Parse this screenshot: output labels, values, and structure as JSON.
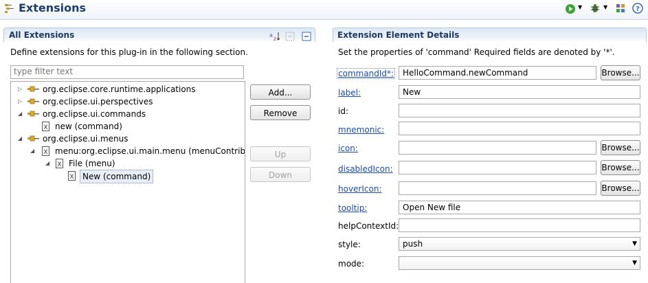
{
  "header": {
    "title": "Extensions"
  },
  "all_extensions": {
    "title": "All Extensions",
    "description": "Define extensions for this plug-in in the following section.",
    "filter_placeholder": "type filter text",
    "tree": [
      {
        "label": "org.eclipse.core.runtime.applications",
        "expanded": false
      },
      {
        "label": "org.eclipse.ui.perspectives",
        "expanded": false
      },
      {
        "label": "org.eclipse.ui.commands",
        "expanded": true
      },
      {
        "label": "new (command)"
      },
      {
        "label": "org.eclipse.ui.menus",
        "expanded": true
      },
      {
        "label": "menu:org.eclipse.ui.main.menu (menuContribution"
      },
      {
        "label": "File (menu)"
      },
      {
        "label": "New (command)",
        "selected": true
      }
    ],
    "buttons": {
      "add": "Add...",
      "remove": "Remove",
      "up": "Up",
      "down": "Down"
    }
  },
  "details": {
    "title": "Extension Element Details",
    "description": "Set the properties of 'command' Required fields are denoted by '*'.",
    "browse": "Browse...",
    "fields": {
      "commandId": {
        "label": "commandId*:",
        "value": "HelloCommand.newCommand"
      },
      "label": {
        "label": "label:",
        "value": "New"
      },
      "id": {
        "label": "id:",
        "value": ""
      },
      "mnemonic": {
        "label": "mnemonic:",
        "value": ""
      },
      "icon": {
        "label": "icon:",
        "value": ""
      },
      "disabledIcon": {
        "label": "disabledIcon:",
        "value": ""
      },
      "hoverIcon": {
        "label": "hoverIcon:",
        "value": ""
      },
      "tooltip": {
        "label": "tooltip:",
        "value": "Open New file"
      },
      "helpContextId": {
        "label": "helpContextId:",
        "value": ""
      },
      "style": {
        "label": "style:",
        "value": "push"
      },
      "mode": {
        "label": "mode:",
        "value": ""
      }
    }
  },
  "colors": {
    "link": "#1a4ca8",
    "title": "#1d3d6b",
    "section_border": "#b8c9e0"
  }
}
